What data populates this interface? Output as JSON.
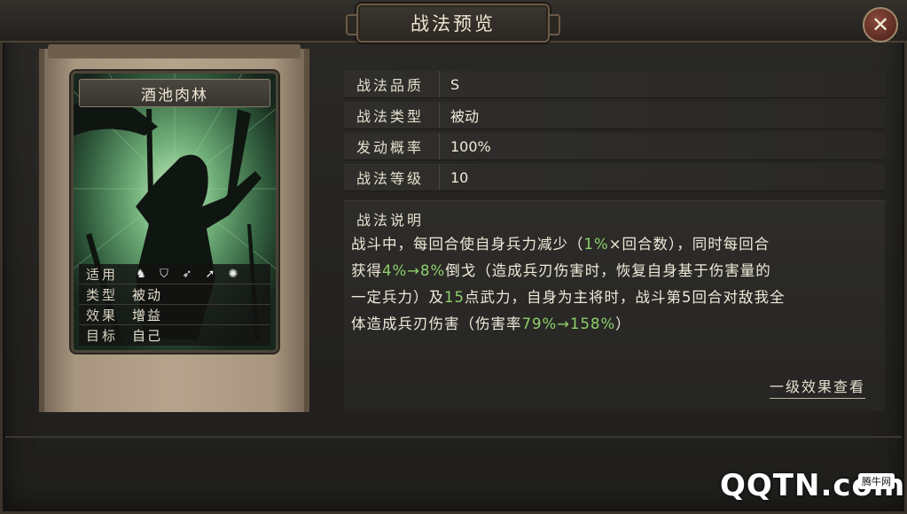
{
  "window": {
    "title": "战法预览",
    "close_label": "✕"
  },
  "skill_card": {
    "name": "酒池肉林",
    "info": [
      {
        "key": "适用",
        "value": ""
      },
      {
        "key": "类型",
        "value": "被动"
      },
      {
        "key": "效果",
        "value": "增益"
      },
      {
        "key": "目标",
        "value": "自己"
      }
    ],
    "unit_icons": [
      "cavalry-icon",
      "shield-icon",
      "bow-icon",
      "spear-icon",
      "wheel-icon"
    ]
  },
  "stats": [
    {
      "key": "战法品质",
      "value": "S"
    },
    {
      "key": "战法类型",
      "value": "被动"
    },
    {
      "key": "发动概率",
      "value": "100%"
    },
    {
      "key": "战法等级",
      "value": "10"
    }
  ],
  "description": {
    "title": "战法说明",
    "line1_a": "战斗中，每回合使自身兵力减少（",
    "line1_g": "1%",
    "line1_b": "×回合数），同时每回合",
    "line2_a": "获得",
    "line2_g": "4%→8%",
    "line2_b": "倒戈（造成兵刃伤害时，恢复自身基于伤害量的",
    "line3_a": "一定兵力）及",
    "line3_g": "15",
    "line3_b": "点武力，自身为主将时，战斗第5回合对敌我全",
    "line4_a": "体造成兵刃伤害（伤害率",
    "line4_g": "79%→158%",
    "line4_b": "）",
    "level_link": "一级效果查看"
  },
  "watermark": {
    "logo": "QQTN.com",
    "badge": "腾牛网"
  },
  "colors": {
    "highlight_green": "#8fd06a",
    "text": "#efe9da"
  }
}
